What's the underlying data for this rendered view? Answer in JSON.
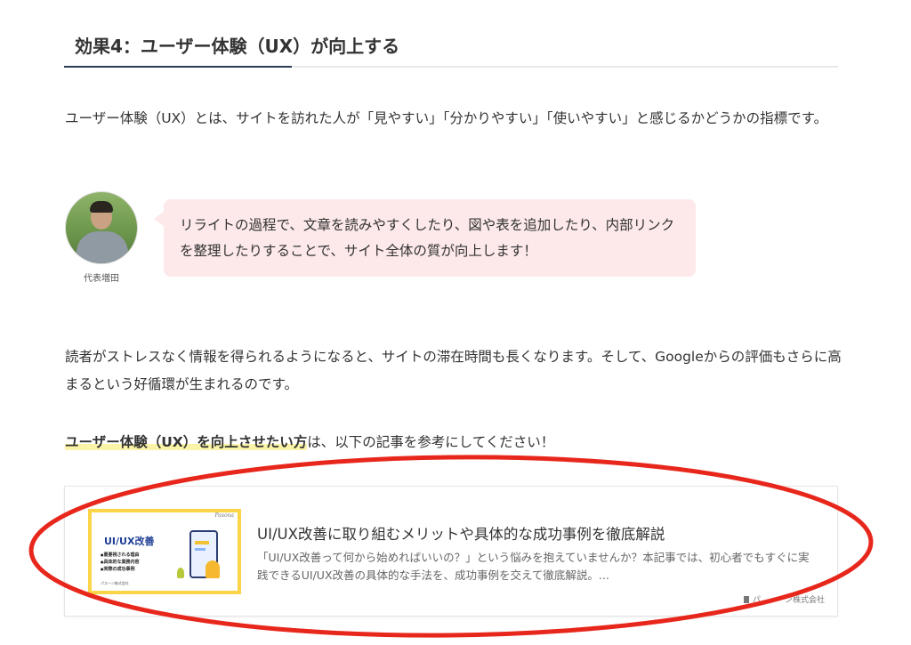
{
  "section_heading": "効果4：ユーザー体験（UX）が向上する",
  "intro_text": "ユーザー体験（UX）とは、サイトを訪れた人が「見やすい」「分かりやすい」「使いやすい」と感じるかどうかの指標です。",
  "speech": {
    "speaker_name": "代表増田",
    "text": "リライトの過程で、文章を読みやすくしたり、図や表を追加したり、内部リンクを整理したりすることで、サイト全体の質が向上します！"
  },
  "body_text": "読者がストレスなく情報を得られるようになると、サイトの滞在時間も長くなります。そして、Googleからの評価もさらに高まるという好循環が生まれるのです。",
  "cta": {
    "highlight": "ユーザー体験（UX）を向上させたい方",
    "rest": "は、以下の記事を参考にしてください！"
  },
  "related_card": {
    "title": "UI/UX改善に取り組むメリットや具体的な成功事例を徹底解説",
    "description": "「UI/UX改善って何から始めればいいの？」という悩みを抱えていませんか？本記事では、初心者でもすぐに実践できるUI/UX改善の具体的な手法を、成功事例を交えて徹底解説。...",
    "source": "パ　　　ン株式会社",
    "thumbnail": {
      "brand": "Pasona",
      "title": "UI/UX改善",
      "bullets": [
        "重要視される理由",
        "具体的な業務内容",
        "実際の成功事例"
      ],
      "footer": "パスーン株式会社"
    }
  },
  "annotation": {
    "shape": "ellipse",
    "color": "#e8271c"
  },
  "colors": {
    "heading_accent": "#2a3b52",
    "bubble_bg": "#fde9ea",
    "highlight": "#fbf3a8",
    "thumb_bg": "#fbd447"
  }
}
